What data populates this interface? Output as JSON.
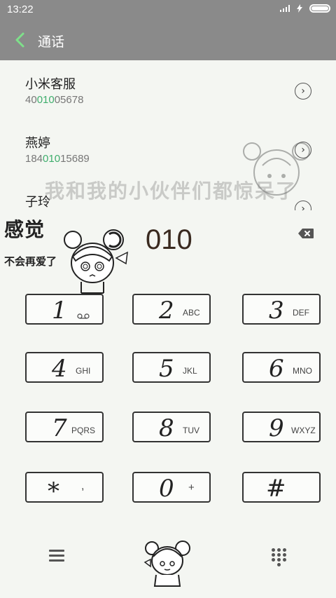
{
  "status": {
    "time": "13:22"
  },
  "appbar": {
    "title": "通话"
  },
  "contacts": [
    {
      "name": "小米客服",
      "number_pre": "40",
      "number_hl": "010",
      "number_post": "05678"
    },
    {
      "name": "燕婷",
      "number_pre": "184",
      "number_hl": "010",
      "number_post": "15689"
    },
    {
      "name": "子玲"
    }
  ],
  "watermark": "我和我的小伙伴们都惊呆了",
  "overlay": {
    "title": "感觉",
    "subtitle": "不会再爱了"
  },
  "dialed": "010",
  "keys": [
    {
      "digit": "1",
      "letters": ""
    },
    {
      "digit": "2",
      "letters": "ABC"
    },
    {
      "digit": "3",
      "letters": "DEF"
    },
    {
      "digit": "4",
      "letters": "GHI"
    },
    {
      "digit": "5",
      "letters": "JKL"
    },
    {
      "digit": "6",
      "letters": "MNO"
    },
    {
      "digit": "7",
      "letters": "PQRS"
    },
    {
      "digit": "8",
      "letters": "TUV"
    },
    {
      "digit": "9",
      "letters": "WXYZ"
    },
    {
      "digit": "*",
      "letters": ","
    },
    {
      "digit": "0",
      "letters": "+"
    },
    {
      "digit": "#",
      "letters": ""
    }
  ],
  "colors": {
    "bar": "#8a8a8a",
    "accent": "#3fae6d",
    "back_arrow": "#7ee08a"
  }
}
